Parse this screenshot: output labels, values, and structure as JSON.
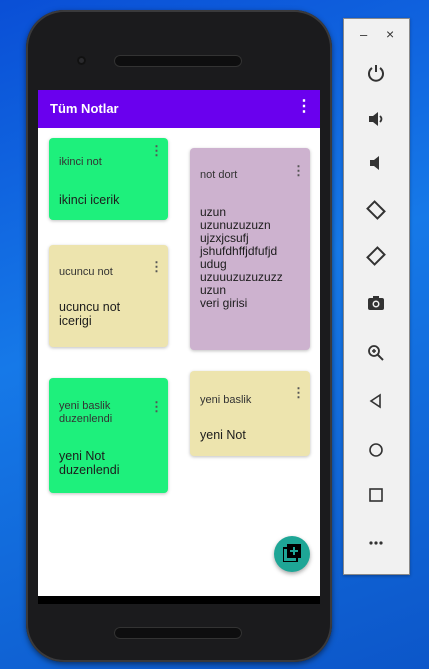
{
  "app": {
    "title": "Tüm Notlar",
    "bar_color": "#6a00ee"
  },
  "notes": [
    {
      "title": "ikinci not",
      "body": "ikinci icerik",
      "color": "#1ef07c"
    },
    {
      "title": "ucuncu not",
      "body": "ucuncu not\nicerigi",
      "color": "#ede4ae"
    },
    {
      "title": "yeni baslik\nduzenlendi",
      "body": "yeni Not\nduzenlendi",
      "color": "#1ef07c"
    },
    {
      "title": "not dort",
      "body": "uzun\nuzunuzuzuzn\nujzxjcsufj\njshufdhffjdfufjd\nudug\nuzuuuzuzuzuzz\nuzun\nveri girisi",
      "color": "#cdb2cf"
    },
    {
      "title": "yeni baslik",
      "body": "yeni Not",
      "color": "#ede4ae"
    }
  ],
  "fab": {
    "icon": "add-note-icon",
    "color": "#1ea696"
  },
  "emulator_panel": {
    "minimize": "–",
    "close": "×",
    "tools": [
      "power-icon",
      "volume-up-icon",
      "volume-down-icon",
      "rotate-left-icon",
      "rotate-right-icon",
      "camera-icon",
      "zoom-icon",
      "back-icon",
      "home-icon",
      "overview-icon",
      "more-icon"
    ]
  }
}
